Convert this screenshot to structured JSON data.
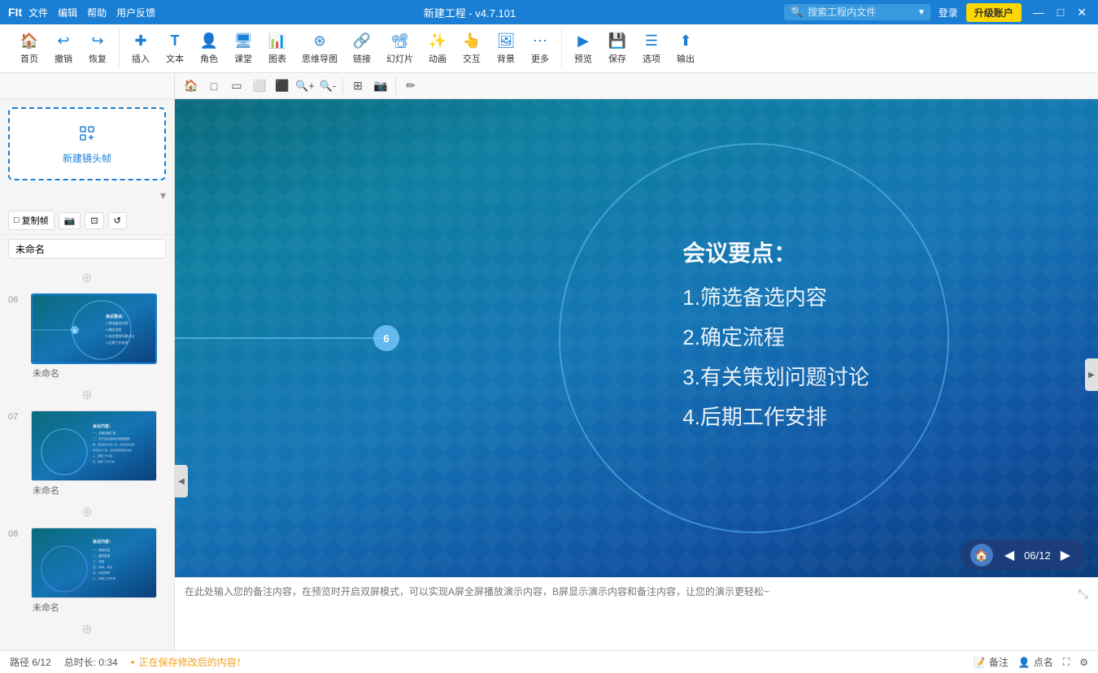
{
  "titlebar": {
    "logo": "FIt",
    "menus": [
      "文件",
      "编辑",
      "帮助",
      "用户反馈"
    ],
    "title": "新建工程 - v4.7.101",
    "search_placeholder": "搜索工程内文件",
    "login_label": "登录",
    "upgrade_label": "升级账户",
    "win_minimize": "—",
    "win_restore": "□",
    "win_close": "✕"
  },
  "toolbar": {
    "items": [
      {
        "id": "home",
        "icon": "🏠",
        "label": "首页"
      },
      {
        "id": "undo",
        "icon": "↩",
        "label": "撤销"
      },
      {
        "id": "redo",
        "icon": "↪",
        "label": "恢复"
      },
      {
        "id": "insert",
        "icon": "⊕",
        "label": "插入"
      },
      {
        "id": "text",
        "icon": "T",
        "label": "文本"
      },
      {
        "id": "role",
        "icon": "👤",
        "label": "角色"
      },
      {
        "id": "class",
        "icon": "🖥",
        "label": "课堂"
      },
      {
        "id": "chart",
        "icon": "📊",
        "label": "图表"
      },
      {
        "id": "mindmap",
        "icon": "⊛",
        "label": "思维导图"
      },
      {
        "id": "link",
        "icon": "🔗",
        "label": "链接"
      },
      {
        "id": "slide",
        "icon": "📽",
        "label": "幻灯片"
      },
      {
        "id": "anim",
        "icon": "✨",
        "label": "动画"
      },
      {
        "id": "interact",
        "icon": "👆",
        "label": "交互"
      },
      {
        "id": "bg",
        "icon": "🖼",
        "label": "背景"
      },
      {
        "id": "more",
        "icon": "⋯",
        "label": "更多"
      },
      {
        "id": "preview",
        "icon": "▶",
        "label": "预览"
      },
      {
        "id": "save",
        "icon": "💾",
        "label": "保存"
      },
      {
        "id": "options",
        "icon": "☰",
        "label": "选项"
      },
      {
        "id": "export",
        "icon": "⬆",
        "label": "输出"
      }
    ]
  },
  "subtoolbar": {
    "icons": [
      "🏠",
      "□",
      "□",
      "□",
      "□",
      "🔍+",
      "🔍-",
      "|",
      "⊞",
      "📷",
      "✏"
    ]
  },
  "sidebar": {
    "new_frame_label": "新建镜头帧",
    "copy_btn": "复制帧",
    "frame_name": "未命名",
    "slides": [
      {
        "num": "06",
        "name": "未命名",
        "active": true,
        "bg": "teal-blue"
      },
      {
        "num": "07",
        "name": "未命名",
        "active": false,
        "bg": "teal-blue-2"
      },
      {
        "num": "08",
        "name": "未命名",
        "active": false,
        "bg": "teal-blue-3"
      }
    ]
  },
  "canvas": {
    "slide_title": "会议要点：",
    "bullet1": "1.筛选备选内容",
    "bullet2": "2.确定流程",
    "bullet3": "3.有关策划问题讨论",
    "bullet4": "4.后期工作安排",
    "dot_label": "6",
    "nav_page": "06/12"
  },
  "notes": {
    "placeholder": "在此处输入您的备注内容，在预览时开启双屏模式，可以实现A屏全屏播放演示内容，B屏显示演示内容和备注内容，让您的演示更轻松~"
  },
  "statusbar": {
    "path": "路径 6/12",
    "duration": "总时长: 0:34",
    "saving": "正在保存修改后的内容！",
    "note_btn": "备注",
    "point_btn": "点名"
  }
}
